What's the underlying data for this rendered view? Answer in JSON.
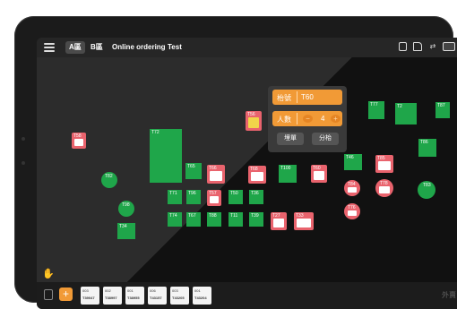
{
  "top_bar": {
    "tabs": [
      {
        "label": "A區",
        "active": true
      },
      {
        "label": "B區",
        "active": false
      },
      {
        "label": "Online ordering",
        "active": false
      },
      {
        "label": "Test",
        "active": false
      }
    ]
  },
  "tables": [
    {
      "label": "T58",
      "style": "red"
    },
    {
      "label": "T56",
      "style": "red-yellow"
    },
    {
      "label": "T72",
      "style": "green"
    },
    {
      "label": "T65",
      "style": "green"
    },
    {
      "label": "T66",
      "style": "red"
    },
    {
      "label": "T68",
      "style": "red"
    },
    {
      "label": "T100",
      "style": "green"
    },
    {
      "label": "T60",
      "style": "red"
    },
    {
      "label": "T77",
      "style": "green"
    },
    {
      "label": "T2",
      "style": "green"
    },
    {
      "label": "T87",
      "style": "green"
    },
    {
      "label": "T86",
      "style": "green"
    },
    {
      "label": "T46",
      "style": "green"
    },
    {
      "label": "T85",
      "style": "red"
    },
    {
      "label": "T83",
      "style": "green"
    },
    {
      "label": "T84",
      "style": "red"
    },
    {
      "label": "T78",
      "style": "red"
    },
    {
      "label": "T76",
      "style": "red"
    },
    {
      "label": "T82",
      "style": "green"
    },
    {
      "label": "T71",
      "style": "green"
    },
    {
      "label": "T96",
      "style": "green"
    },
    {
      "label": "T57",
      "style": "red"
    },
    {
      "label": "T50",
      "style": "green"
    },
    {
      "label": "T36",
      "style": "green"
    },
    {
      "label": "T74",
      "style": "green"
    },
    {
      "label": "T67",
      "style": "green"
    },
    {
      "label": "T88",
      "style": "green"
    },
    {
      "label": "T11",
      "style": "green"
    },
    {
      "label": "T39",
      "style": "green"
    },
    {
      "label": "T27",
      "style": "red"
    },
    {
      "label": "T33",
      "style": "red"
    },
    {
      "label": "T98",
      "style": "green"
    },
    {
      "label": "T34",
      "style": "green"
    }
  ],
  "popup": {
    "table_label": "枱號",
    "table_value": "T60",
    "people_label": "人數",
    "people_value": "4",
    "minus": "−",
    "plus": "+",
    "btn_bill": "埋單",
    "btn_split": "分枱"
  },
  "bottom_bar": {
    "add": "+",
    "outside_label": "外賣",
    "orders": [
      {
        "num": "003",
        "code": "T39047"
      },
      {
        "num": "002",
        "code": "T38997"
      },
      {
        "num": "001",
        "code": "T38955"
      },
      {
        "num": "006",
        "code": "T43157"
      },
      {
        "num": "003",
        "code": "T43205"
      },
      {
        "num": "001",
        "code": "T43204"
      }
    ]
  }
}
